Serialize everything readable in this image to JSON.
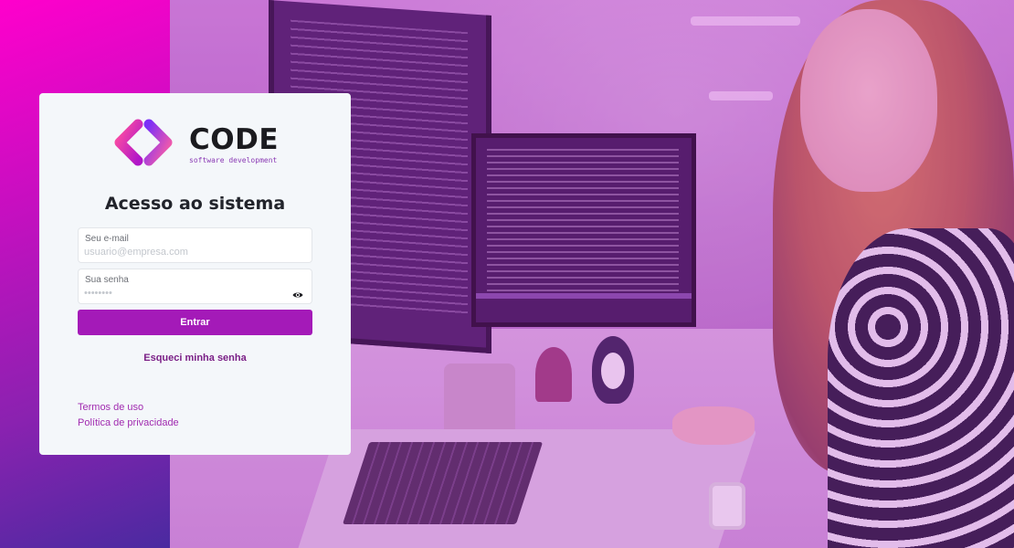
{
  "brand": {
    "name": "CODE",
    "tagline": "software development",
    "colors": {
      "primary": "#a41ab8",
      "gradient_start": "#ff00cc",
      "gradient_end": "#4a2aa0"
    }
  },
  "login": {
    "title": "Acesso ao sistema",
    "email": {
      "label": "Seu e-mail",
      "placeholder": "usuario@empresa.com",
      "value": ""
    },
    "password": {
      "label": "Sua senha",
      "placeholder": "••••••••",
      "value": "",
      "toggle_icon": "eye-icon"
    },
    "submit_label": "Entrar",
    "forgot_label": "Esqueci minha senha"
  },
  "footer_links": [
    {
      "label": "Termos de uso"
    },
    {
      "label": "Política de privacidade"
    }
  ]
}
